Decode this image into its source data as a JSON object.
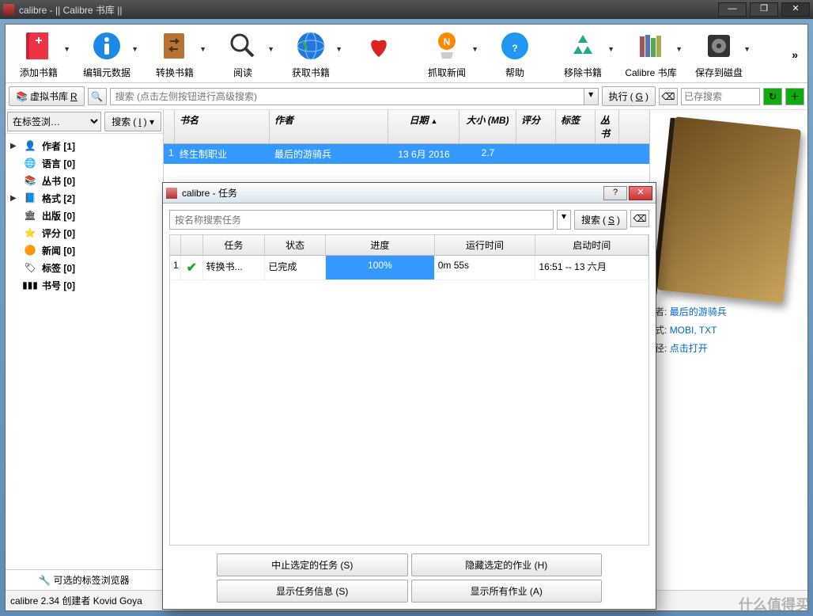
{
  "window": {
    "title": "calibre - || Calibre 书库 ||"
  },
  "toolbar": {
    "add": "添加书籍",
    "edit": "编辑元数据",
    "convert": "转换书籍",
    "read": "阅读",
    "fetch": "获取书籍",
    "news": "抓取新闻",
    "help": "帮助",
    "remove": "移除书籍",
    "library": "Calibre 书库",
    "save": "保存到磁盘"
  },
  "searchbar": {
    "vlib": "虚拟书库",
    "vlib_tag": "R",
    "placeholder": "搜索 (点击左侧按钮进行高级搜索)",
    "go": "执行",
    "go_key": "G",
    "saved": "已存搜索"
  },
  "sidebar": {
    "tag_browse": "在标签浏…",
    "search": "搜索",
    "search_key": "I",
    "items": [
      {
        "label": "作者 [1]"
      },
      {
        "label": "语言 [0]"
      },
      {
        "label": "丛书 [0]"
      },
      {
        "label": "格式 [2]"
      },
      {
        "label": "出版 [0]"
      },
      {
        "label": "评分 [0]"
      },
      {
        "label": "新闻 [0]"
      },
      {
        "label": "标签 [0]"
      },
      {
        "label": "书号 [0]"
      }
    ],
    "footer": "可选的标签浏览器"
  },
  "columns": {
    "title": "书名",
    "author": "作者",
    "date": "日期",
    "size": "大小 (MB)",
    "rating": "评分",
    "tags": "标签",
    "series": "丛书"
  },
  "books": [
    {
      "n": "1",
      "title": "终生制职业",
      "author": "最后的游骑兵",
      "date": "13 6月 2016",
      "size": "2.7"
    }
  ],
  "details": {
    "author_lbl": "者:",
    "author": "最后的游骑兵",
    "format_lbl": "式:",
    "formats": "MOBI, TXT",
    "path_lbl": "径:",
    "path": "点击打开"
  },
  "status": "calibre 2.34 创建者 Kovid Goya",
  "dialog": {
    "title": "calibre - 任务",
    "search_ph": "按名称搜索任务",
    "search": "搜索",
    "search_key": "S",
    "cols": {
      "task": "任务",
      "status": "状态",
      "progress": "进度",
      "runtime": "运行时间",
      "start": "启动时间"
    },
    "jobs": [
      {
        "n": "1",
        "task": "转换书...",
        "status": "已完成",
        "progress": "100%",
        "runtime": "0m 55s",
        "start": "16:51 -- 13 六月"
      }
    ],
    "btns": {
      "stop": "中止选定的任务 (S)",
      "hide": "隐藏选定的作业 (H)",
      "info": "显示任务信息 (S)",
      "showall": "显示所有作业 (A)"
    }
  },
  "watermark": "什么值得买"
}
